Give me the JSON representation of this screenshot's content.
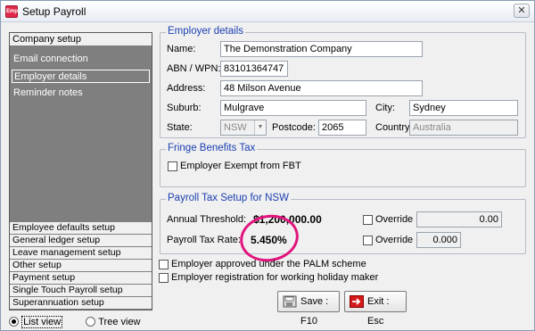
{
  "window": {
    "title": "Setup Payroll",
    "icon_text": "Emp"
  },
  "nav": {
    "header": "Company setup",
    "items": [
      {
        "label": "Email connection"
      },
      {
        "label": "Employer details"
      },
      {
        "label": "Reminder notes"
      }
    ],
    "bottom": [
      {
        "label": "Employee defaults setup"
      },
      {
        "label": "General ledger setup"
      },
      {
        "label": "Leave management setup"
      },
      {
        "label": "Other setup"
      },
      {
        "label": "Payment setup"
      },
      {
        "label": "Single Touch Payroll setup"
      },
      {
        "label": "Superannuation setup"
      }
    ]
  },
  "view": {
    "list": "List view",
    "tree": "Tree view"
  },
  "employer": {
    "title": "Employer details",
    "name_label": "Name:",
    "name": "The Demonstration Company",
    "abn_label": "ABN / WPN:",
    "abn": "83101364747",
    "address_label": "Address:",
    "address": "48 Milson Avenue",
    "suburb_label": "Suburb:",
    "suburb": "Mulgrave",
    "city_label": "City:",
    "city": "Sydney",
    "state_label": "State:",
    "state": "NSW",
    "postcode_label": "Postcode:",
    "postcode": "2065",
    "country_label": "Country:",
    "country": "Australia"
  },
  "fbt": {
    "title": "Fringe Benefits Tax",
    "exempt_label": "Employer Exempt from FBT"
  },
  "payroll_tax": {
    "title": "Payroll Tax Setup for NSW",
    "threshold_label": "Annual Threshold:",
    "threshold": "$1,200,000.00",
    "rate_label": "Payroll Tax Rate:",
    "rate": "5.450%",
    "override_label": "Override",
    "override_threshold": "0.00",
    "override_rate": "0.000"
  },
  "options": {
    "palm": "Employer approved under the PALM scheme",
    "working_holiday": "Employer registration for working holiday maker"
  },
  "buttons": {
    "save": "Save : F10",
    "exit": "Exit : Esc"
  },
  "colors": {
    "accent_title": "#1a3fb0",
    "annotation": "#e0157d",
    "nav_bg": "#7f7f7f"
  }
}
